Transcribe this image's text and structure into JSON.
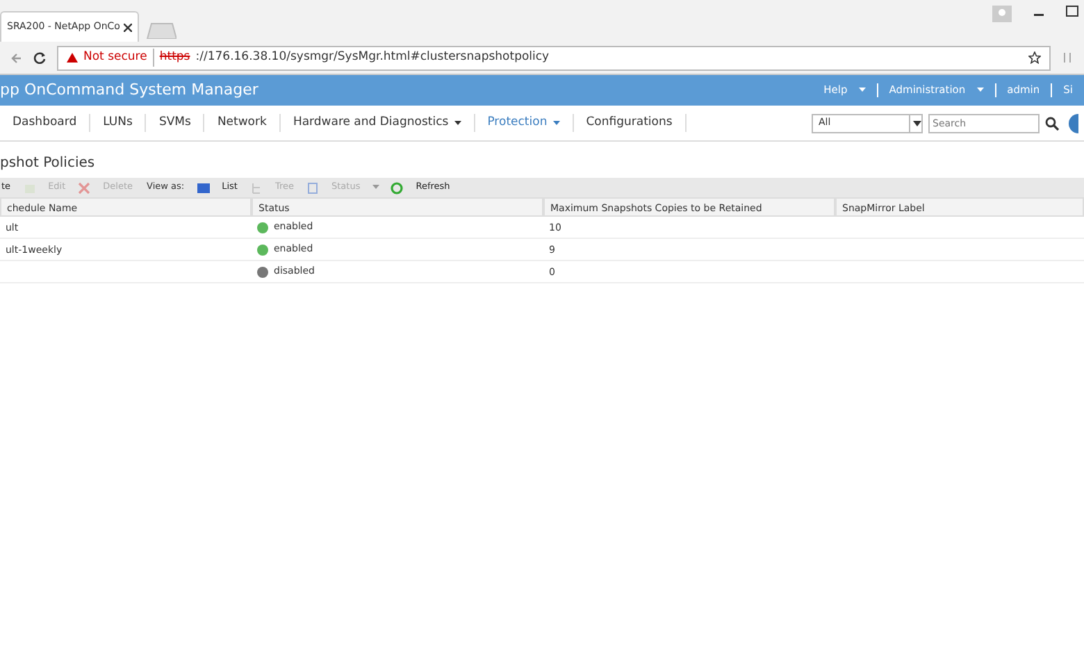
{
  "browser": {
    "tab_title": "SRA200 - NetApp OnCo",
    "security": "Not secure",
    "url_scheme": "https",
    "url_rest": "://176.16.38.10/sysmgr/SysMgr.html#clustersnapshotpolicy"
  },
  "app": {
    "title": "pp OnCommand System Manager",
    "header_links": [
      {
        "label": "Help",
        "dropdown": true
      },
      {
        "label": "Administration",
        "dropdown": true
      },
      {
        "label": "admin",
        "dropdown": false
      },
      {
        "label": "Si",
        "dropdown": false
      }
    ]
  },
  "nav": [
    {
      "label": "Dashboard",
      "selected": false,
      "dropdown": false
    },
    {
      "label": "LUNs",
      "selected": false,
      "dropdown": false
    },
    {
      "label": "SVMs",
      "selected": false,
      "dropdown": false
    },
    {
      "label": "Network",
      "selected": false,
      "dropdown": false
    },
    {
      "label": "Hardware and Diagnostics",
      "selected": false,
      "dropdown": true
    },
    {
      "label": "Protection",
      "selected": true,
      "dropdown": true
    },
    {
      "label": "Configurations",
      "selected": false,
      "dropdown": false
    }
  ],
  "search": {
    "scope": "All",
    "placeholder": "Search"
  },
  "page_title": "pshot Policies",
  "toolbar": [
    {
      "kind": "button",
      "label": "te",
      "disabled": false
    },
    {
      "kind": "button",
      "label": "Edit",
      "disabled": true
    },
    {
      "kind": "button",
      "label": "Delete",
      "disabled": true
    },
    {
      "kind": "text",
      "label": "View as:"
    },
    {
      "kind": "button",
      "label": "List",
      "disabled": false
    },
    {
      "kind": "button",
      "label": "Tree",
      "disabled": true
    },
    {
      "kind": "button",
      "label": "Status",
      "disabled": true
    },
    {
      "kind": "button",
      "label": "Refresh",
      "disabled": false
    }
  ],
  "table": {
    "columns": [
      "chedule Name",
      "Status",
      "Maximum Snapshots Copies to be Retained",
      "SnapMirror Label"
    ],
    "rows": [
      {
        "name": "ult",
        "status": "enabled",
        "enabled": true,
        "max": "10"
      },
      {
        "name": "ult-1weekly",
        "status": "enabled",
        "enabled": true,
        "max": "9"
      },
      {
        "status": "disabled",
        "enabled": false,
        "max": "0"
      }
    ]
  }
}
